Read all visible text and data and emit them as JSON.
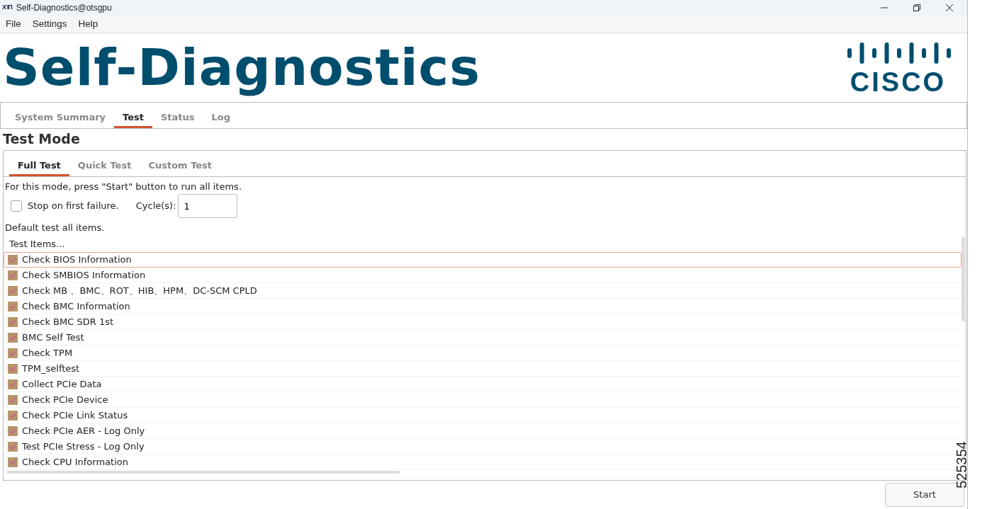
{
  "window": {
    "title": "Self-Diagnostics@otsgpu",
    "app_icon_text": "ΧΊΠ"
  },
  "menu": [
    "File",
    "Settings",
    "Help"
  ],
  "header": {
    "title": "Self-Diagnostics",
    "logo_text": "CISCO"
  },
  "tabs": [
    {
      "label": "System Summary",
      "selected": false
    },
    {
      "label": "Test",
      "selected": true
    },
    {
      "label": "Status",
      "selected": false
    },
    {
      "label": "Log",
      "selected": false
    }
  ],
  "section_title": "Test Mode",
  "mode_tabs": [
    {
      "label": "Full Test",
      "selected": true
    },
    {
      "label": "Quick Test",
      "selected": false
    },
    {
      "label": "Custom Test",
      "selected": false
    }
  ],
  "instruction": "For this mode, press \"Start\" button to run all items.",
  "stop_on_failure": {
    "label": "Stop on first failure.",
    "checked": false
  },
  "cycles": {
    "label": "Cycle(s):",
    "value": "1"
  },
  "default_note": "Default test all items.",
  "list_header": "Test Items...",
  "test_items": [
    {
      "label": "Check BIOS Information",
      "checked": true,
      "selected": true
    },
    {
      "label": "Check SMBIOS Information",
      "checked": true,
      "selected": false
    },
    {
      "label": "Check MB 、BMC、ROT、HIB、HPM、DC-SCM CPLD",
      "checked": true,
      "selected": false
    },
    {
      "label": "Check BMC Information",
      "checked": true,
      "selected": false
    },
    {
      "label": "Check BMC SDR 1st",
      "checked": true,
      "selected": false
    },
    {
      "label": "BMC Self Test",
      "checked": true,
      "selected": false
    },
    {
      "label": "Check TPM",
      "checked": true,
      "selected": false
    },
    {
      "label": "TPM_selftest",
      "checked": true,
      "selected": false
    },
    {
      "label": "Collect PCIe Data",
      "checked": true,
      "selected": false
    },
    {
      "label": "Check PCIe Device",
      "checked": true,
      "selected": false
    },
    {
      "label": "Check PCIe Link Status",
      "checked": true,
      "selected": false
    },
    {
      "label": "Check PCIe AER - Log Only",
      "checked": true,
      "selected": false
    },
    {
      "label": "Test PCIe Stress - Log Only",
      "checked": true,
      "selected": false
    },
    {
      "label": "Check CPU Information",
      "checked": true,
      "selected": false
    }
  ],
  "start_button": "Start",
  "figure_id": "525354"
}
